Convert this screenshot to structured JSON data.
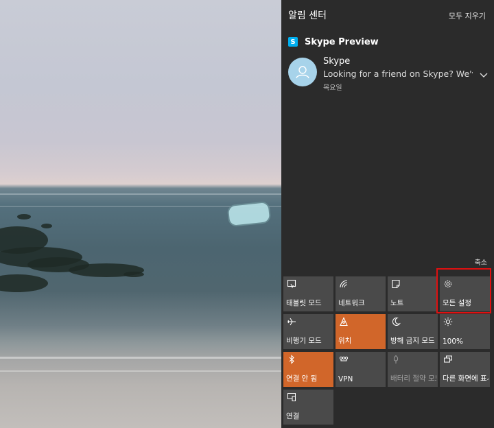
{
  "action_center": {
    "title": "알림 센터",
    "clear_all": "모두 지우기",
    "collapse": "축소"
  },
  "notification_group": {
    "app_name": "Skype Preview",
    "app_icon": "skype-logo-icon",
    "items": [
      {
        "sender": "Skype",
        "message": "Looking for a friend on Skype? We've",
        "time": "목요일"
      }
    ]
  },
  "quick_actions": [
    {
      "label": "태블릿 모드",
      "icon": "tablet-mode-icon",
      "state": "off"
    },
    {
      "label": "네트워크",
      "icon": "network-icon",
      "state": "off"
    },
    {
      "label": "노트",
      "icon": "note-icon",
      "state": "off"
    },
    {
      "label": "모든 설정",
      "icon": "gear-icon",
      "state": "off"
    },
    {
      "label": "비행기 모드",
      "icon": "airplane-icon",
      "state": "off"
    },
    {
      "label": "위치",
      "icon": "location-icon",
      "state": "on"
    },
    {
      "label": "방해 금지 모드",
      "icon": "moon-icon",
      "state": "off"
    },
    {
      "label": "100%",
      "icon": "brightness-icon",
      "state": "off"
    },
    {
      "label": "연결 안 됨",
      "icon": "bluetooth-icon",
      "state": "on"
    },
    {
      "label": "VPN",
      "icon": "vpn-icon",
      "state": "off"
    },
    {
      "label": "배터리 절약 모드",
      "icon": "battery-saver-icon",
      "state": "disabled"
    },
    {
      "label": "다른 화면에 표시",
      "icon": "project-icon",
      "state": "off"
    },
    {
      "label": "연결",
      "icon": "connect-icon",
      "state": "off"
    }
  ],
  "colors": {
    "panel_bg": "#2b2b2b",
    "tile_bg": "#4a4a4a",
    "tile_active": "#d1662a",
    "highlight": "#e01010"
  }
}
